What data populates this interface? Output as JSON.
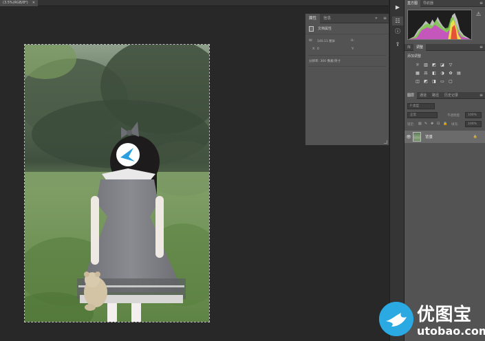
{
  "document": {
    "tab_label": "(3.5%(RGB/8*)",
    "close_glyph": "×"
  },
  "properties_panel": {
    "tabs": [
      "属性",
      "信息"
    ],
    "collapse_glyph": "»",
    "menu_glyph": "≡",
    "section_label": "文档属性",
    "width_label": "W:",
    "width_value": "140.11 厘米",
    "height_label": "H:",
    "x_label": "X:",
    "x_value": "0",
    "y_label": "Y:",
    "resolution_text": "分辨率: 300 像素/英寸"
  },
  "icon_strip": {
    "play_icon": "▶",
    "properties_icon": "☷",
    "info_icon": "ⓘ",
    "adjust_icon": "⇪"
  },
  "histogram_panel": {
    "tabs": [
      "直方图",
      "导航器"
    ],
    "menu_glyph": "≡",
    "warning_glyph": "⚠"
  },
  "adjustments_panel": {
    "tabs": [
      "库",
      "调整"
    ],
    "menu_glyph": "≡",
    "title": "添加调整",
    "rows": [
      [
        "☼",
        "▥",
        "◩",
        "◪",
        "▽"
      ],
      [
        "▦",
        "⚖",
        "◧",
        "◑",
        "✿",
        "▤"
      ],
      [
        "◫",
        "◩",
        "◨",
        "▭",
        "▢"
      ]
    ]
  },
  "layers_panel": {
    "tabs": [
      "图层",
      "通道",
      "路径",
      "历史记录"
    ],
    "menu_glyph": "≡",
    "filter_placeholder": "P 类型",
    "blend_mode": "正常",
    "opacity_label": "不透明度:",
    "opacity_value": "100%",
    "lock_label": "锁定:",
    "fill_label": "填充:",
    "fill_value": "100%",
    "lock_icons": [
      "▧",
      "✎",
      "✥",
      "⊡",
      "🔒"
    ],
    "layer_name": "背景",
    "visibility_glyph": "👁",
    "layer_lock_glyph": "🔒"
  },
  "watermark": {
    "title": "优图宝",
    "url": "utobao.com"
  }
}
